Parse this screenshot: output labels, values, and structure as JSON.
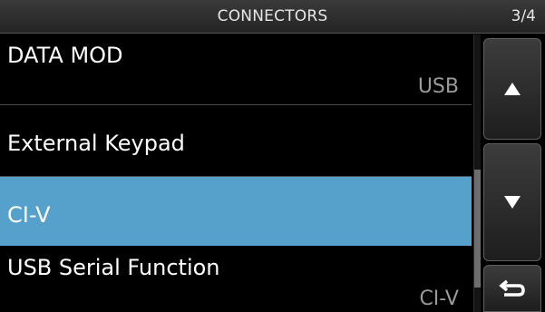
{
  "header": {
    "title": "CONNECTORS",
    "page": "3/4"
  },
  "menu": {
    "items": [
      {
        "label": "DATA MOD",
        "value": "USB",
        "selected": false
      },
      {
        "label": "External Keypad",
        "value": "",
        "selected": false
      },
      {
        "label": "CI-V",
        "value": "",
        "selected": true
      },
      {
        "label": "USB Serial Function",
        "value": "CI-V",
        "selected": false
      }
    ]
  },
  "buttons": {
    "up_icon": "triangle-up-icon",
    "down_icon": "triangle-down-icon",
    "back_icon": "return-arrow-icon"
  },
  "colors": {
    "selected_row": "#56a0cc",
    "background": "#000000",
    "value_text": "#9a9a9a"
  }
}
